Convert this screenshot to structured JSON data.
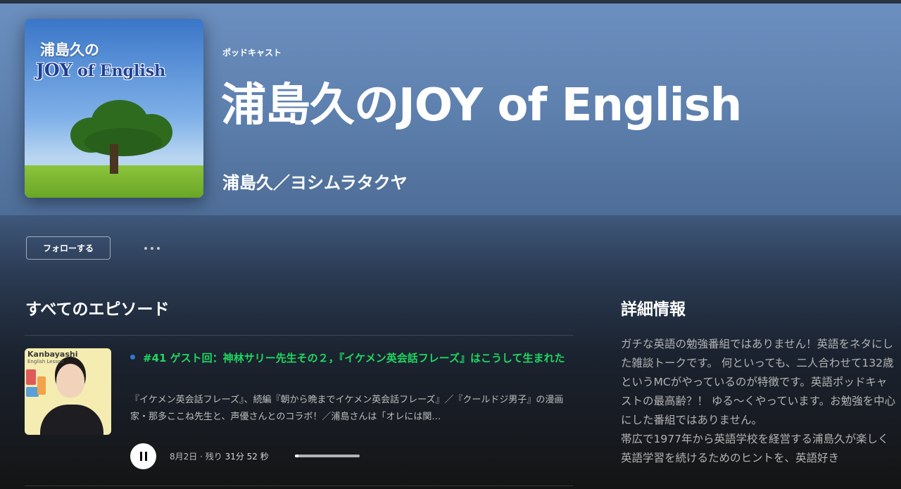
{
  "header": {
    "type_label": "ポッドキャスト",
    "title": "浦島久のJOY of English",
    "author": "浦島久／ヨシムラタクヤ"
  },
  "cover": {
    "line1": "浦島久の",
    "line2_joy": "JOY",
    "line2_rest": " of English"
  },
  "actions": {
    "follow_label": "フォローする"
  },
  "episodes_section": {
    "title": "すべてのエピソード"
  },
  "episode": {
    "thumb_title": "Kanbayashi",
    "thumb_subtitle": "English Lesson",
    "title": "#41 ゲスト回：神林サリー先生その２，『イケメン英会話フレーズ』はこうして生まれた",
    "description": "『イケメン英会話フレーズ』、続編『朝から晩までイケメン英会話フレーズ』／『クールドジ男子』の漫画家・那多ここね先生と、声優さんとのコラボ！／浦島さんは「オレには関…",
    "date": "8月2日",
    "separator": " · ",
    "remaining_prefix": "残り ",
    "remaining": "31分 52 秒",
    "progress": 0.05
  },
  "details": {
    "title": "詳細情報",
    "text": "ガチな英語の勉強番組ではありません！英語をネタにした雑談トークです。 何といっても、二人合わせて132歳というMCがやっているのが特徴です。英語ポッドキャストの最高齢？！ ゆる〜くやっています。お勉強を中心にした番組ではありません。\n帯広で1977年から英語学校を経営する浦島久が楽しく英語学習を続けるためのヒントを、英語好き"
  },
  "colors": {
    "accent_green": "#1ed760",
    "hero_blue": "#6b8fbf",
    "unplayed_dot": "#2e77d0"
  },
  "icons": {
    "more": "more-dots-icon",
    "pause": "pause-icon"
  }
}
